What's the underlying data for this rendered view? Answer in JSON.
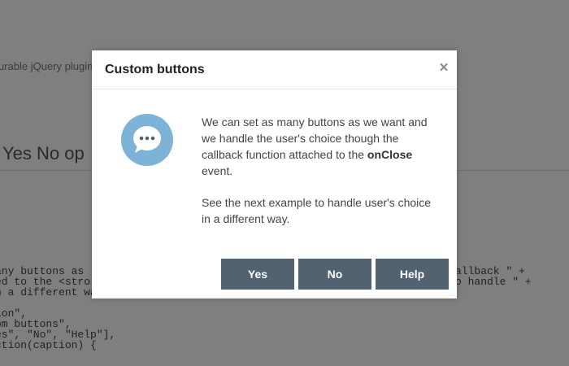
{
  "background": {
    "intro_text": "urable jQuery plugin",
    "heading": "Yes No op",
    "code_left": [
      "any buttons as",
      "ed to the <stro",
      "n a different way\");",
      "",
      "ion\",",
      "om buttons\",",
      "es\", \"No\", \"Help\"],",
      "ction(caption) {"
    ],
    "code_right": [
      "allback \" +",
      "o handle \" +"
    ]
  },
  "dialog": {
    "title": "Custom buttons",
    "close_symbol": "×",
    "icon": "speech-bubble-icon",
    "body": {
      "para1_before": "We can set as many buttons as we want and we handle the user's choice though the callback function attached to the ",
      "para1_bold": "onClose",
      "para1_after": " event.",
      "para2": "See the next example to handle user's choice in a different way."
    },
    "buttons": {
      "yes": "Yes",
      "no": "No",
      "help": "Help"
    }
  },
  "colors": {
    "overlay": "rgba(0,0,0,0.5)",
    "button_bg": "#526270",
    "icon_bg": "#7db3d6"
  }
}
